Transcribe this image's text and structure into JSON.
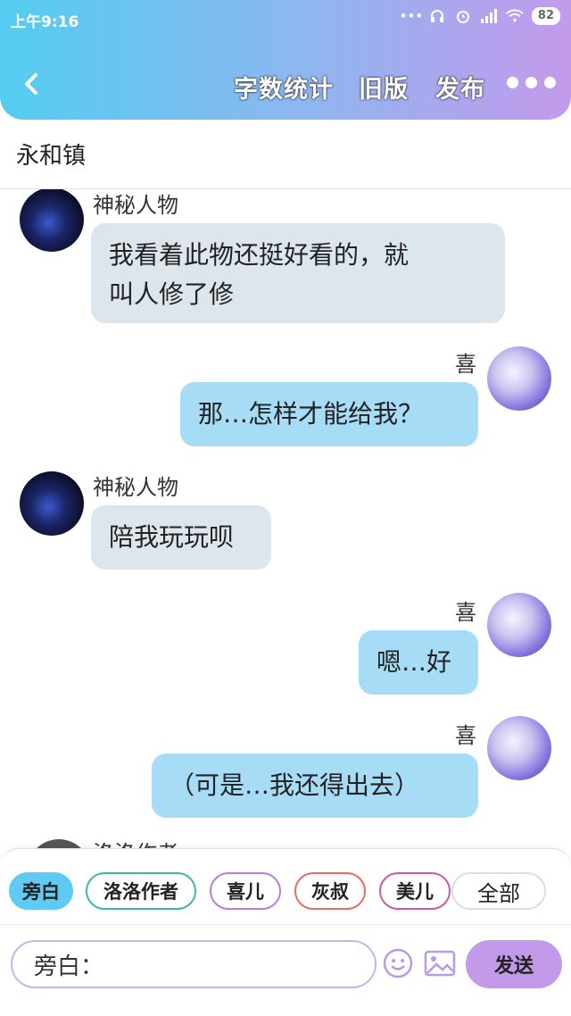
{
  "status": {
    "time": "上午9:16",
    "battery": "82"
  },
  "nav": {
    "word_count": "字数统计",
    "old_version": "旧版",
    "publish": "发布"
  },
  "chapter_title": "永和镇",
  "messages": [
    {
      "side": "left",
      "name": "神秘人物",
      "lines": [
        "我看着此物还挺好看的，就",
        "叫人修了修"
      ]
    },
    {
      "side": "right",
      "name": "喜",
      "lines": [
        "那…怎样才能给我？"
      ]
    },
    {
      "side": "left",
      "name": "神秘人物",
      "lines": [
        "陪我玩玩呗"
      ]
    },
    {
      "side": "right",
      "name": "喜",
      "lines": [
        "嗯…好"
      ]
    },
    {
      "side": "right",
      "name": "喜",
      "lines": [
        "（可是…我还得出去）"
      ]
    },
    {
      "side": "left",
      "name": "洛洛作者",
      "lines": []
    }
  ],
  "chips": {
    "narration": "旁白",
    "author": "洛洛作者",
    "xi": "喜儿",
    "hui": "灰叔",
    "mei": "美儿",
    "all": "全部"
  },
  "input": {
    "value": "旁白："
  },
  "send_label": "发送",
  "colors": {
    "header_start": "#54cdf0",
    "header_end": "#c39aec",
    "bubble_gray": "#dde5ed",
    "bubble_blue": "#a6dcf5",
    "send": "#c39ae9"
  }
}
